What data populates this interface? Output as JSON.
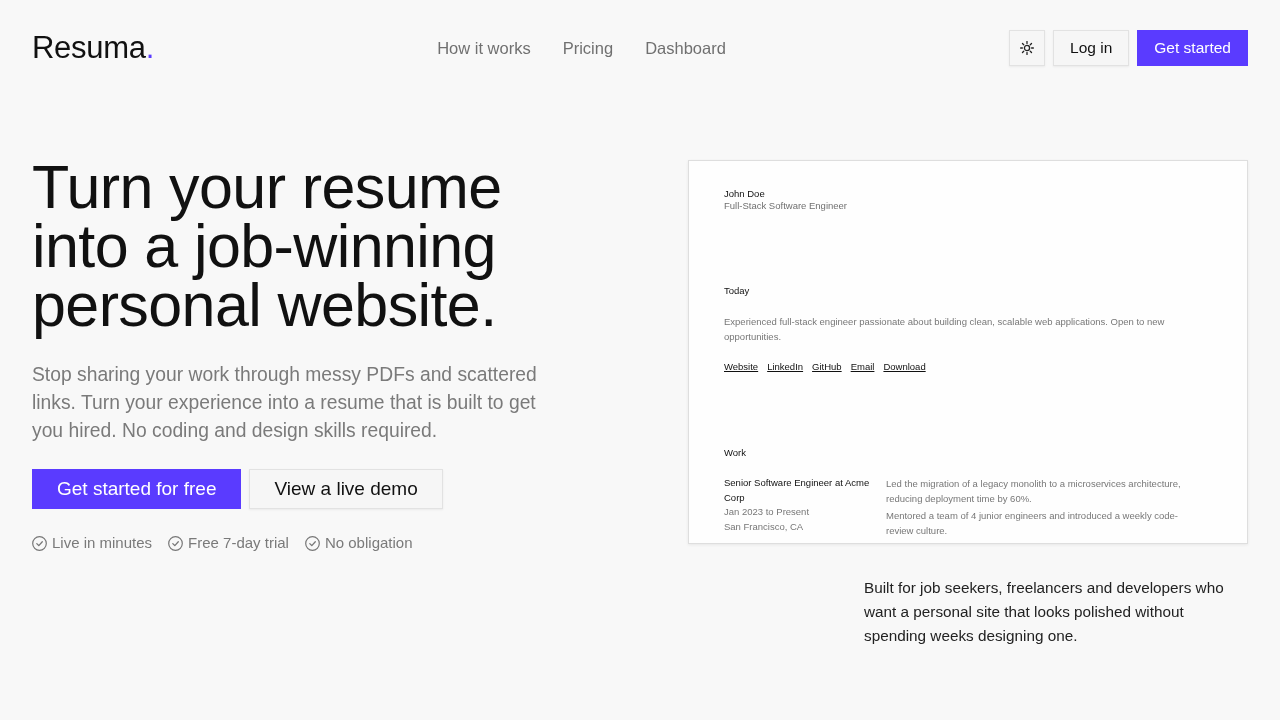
{
  "brand": {
    "name": "Resuma",
    "accent": "."
  },
  "nav": {
    "links": [
      "How it works",
      "Pricing",
      "Dashboard"
    ],
    "actions": [
      {
        "kind": "icon"
      },
      {
        "kind": "outline",
        "label": "Log in"
      },
      {
        "kind": "primary",
        "label": "Get started"
      }
    ]
  },
  "hero": {
    "headline": "Turn your resume into a job-winning personal website.",
    "description": "Stop sharing your work through messy PDFs and scattered links. Turn your experience into a resume that is built to get you hired. No coding and design skills required.",
    "buttons": [
      {
        "kind": "primary",
        "label": "Get started for free"
      },
      {
        "kind": "outline",
        "label": "View a live demo"
      }
    ],
    "perks": [
      "Live in minutes",
      "Free 7-day trial",
      "No obligation"
    ]
  },
  "preview": {
    "name": "John Doe",
    "role": "Full-Stack Software Engineer",
    "sections": [
      {
        "kind": "summary",
        "title": "Today",
        "text": "Experienced full-stack engineer passionate about building clean, scalable web applications. Open to new opportunities.",
        "links": [
          "Website",
          "LinkedIn",
          "GitHub",
          "Email",
          "Download"
        ]
      },
      {
        "kind": "work",
        "title": "Work",
        "entries": [
          {
            "title": "Senior Software Engineer at Acme Corp",
            "dates": "Jan 2023 to Present",
            "location": "San Francisco, CA",
            "bullets": [
              "Led the migration of a legacy monolith to a microservices architecture, reducing deployment time by 60%.",
              "Mentored a team of 4 junior engineers and introduced a weekly code-review culture."
            ]
          }
        ]
      }
    ]
  },
  "tagline": "Built for job seekers, freelancers and developers who want a personal site that looks polished without spending weeks designing one."
}
